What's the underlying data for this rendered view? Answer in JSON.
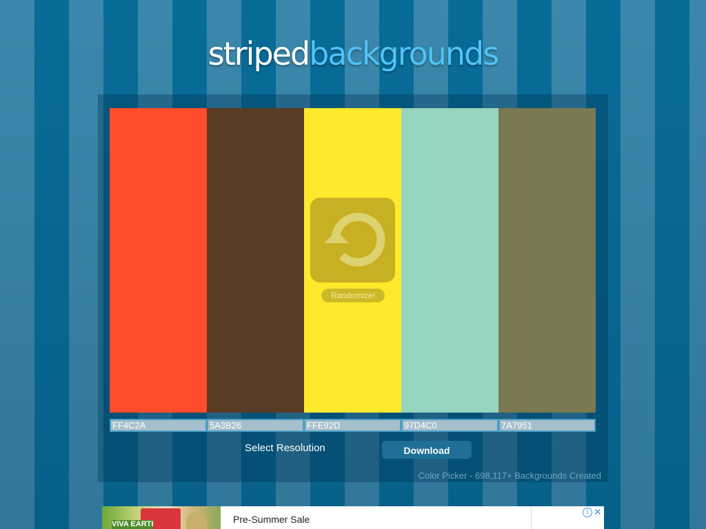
{
  "logo": {
    "part1": "striped",
    "part2": "backgrounds"
  },
  "colors": [
    {
      "hex": "#FF4C2A",
      "code": "FF4C2A"
    },
    {
      "hex": "#5A3B26",
      "code": "5A3B26"
    },
    {
      "hex": "#FFE92D",
      "code": "FFE92D"
    },
    {
      "hex": "#97D4C0",
      "code": "97D4C0"
    },
    {
      "hex": "#7A7951",
      "code": "7A7951"
    }
  ],
  "randomize": {
    "label": "Randomize!",
    "icon": "refresh-icon"
  },
  "controls": {
    "select_resolution": "Select Resolution",
    "download": "Download"
  },
  "footer": {
    "text": "Color Picker - 698,117+ Backgrounds Created"
  },
  "ad": {
    "headline": "Pre-Summer Sale",
    "brand_text": "VIVA EARTH",
    "info_icon": "info-icon",
    "close_icon": "close-icon"
  },
  "theme": {
    "stripe_light": "#3b88ac",
    "stripe_dark": "#086c98",
    "logo_accent": "#4fc3f7"
  }
}
